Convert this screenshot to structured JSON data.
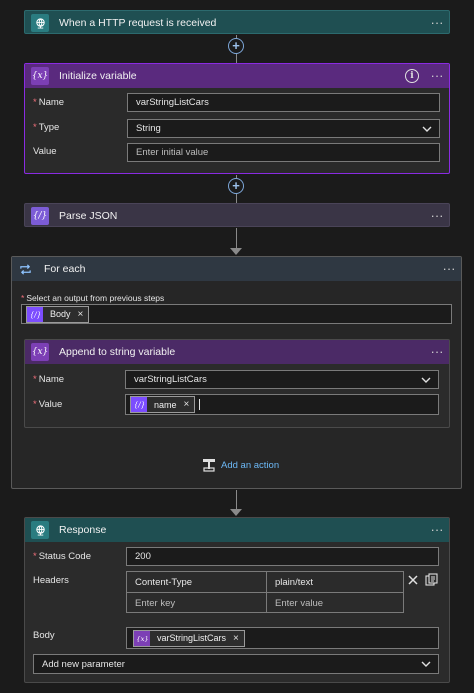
{
  "colors": {
    "http_accent": "#1f5c5e",
    "variable_accent": "#6a2c91",
    "foreach_accent": "#2f3640",
    "card_bg": "#2b2b2b",
    "selected_border": "#8a2be2",
    "required": "#f1707b",
    "link": "#6cb8f6"
  },
  "trigger": {
    "title": "When a HTTP request is received",
    "icon": "globe-icon"
  },
  "init_variable": {
    "title": "Initialize variable",
    "icon": "variable-icon",
    "name_label": "Name",
    "name_value": "varStringListCars",
    "type_label": "Type",
    "type_value": "String",
    "value_label": "Value",
    "value_placeholder": "Enter initial value"
  },
  "parse_json": {
    "title": "Parse JSON",
    "icon": "variable-icon"
  },
  "for_each": {
    "title": "For each",
    "icon": "loop-icon",
    "select_label": "Select an output from previous steps",
    "token_label": "Body",
    "token_remove": "×",
    "add_action": "Add an action"
  },
  "append": {
    "title": "Append to string variable",
    "icon": "variable-icon",
    "name_label": "Name",
    "name_value": "varStringListCars",
    "value_label": "Value",
    "token_label": "name",
    "token_remove": "×"
  },
  "response": {
    "title": "Response",
    "icon": "globe-icon",
    "status_label": "Status Code",
    "status_value": "200",
    "headers_label": "Headers",
    "header_key": "Content-Type",
    "header_value": "plain/text",
    "key_placeholder": "Enter key",
    "value_placeholder": "Enter value",
    "body_label": "Body",
    "body_token": "varStringListCars",
    "token_remove": "×",
    "add_param": "Add new parameter"
  },
  "required_mark": "*",
  "ellipsis": "···",
  "plus_symbol": "+",
  "info_symbol": "i"
}
